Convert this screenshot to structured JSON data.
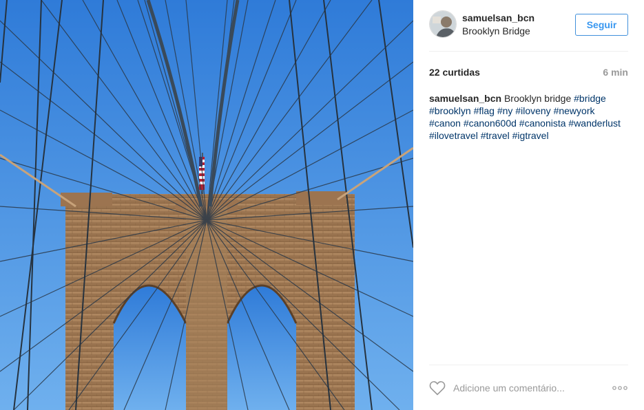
{
  "post": {
    "user": {
      "username": "samuelsan_bcn",
      "location": "Brooklyn Bridge",
      "avatar_icon": "user-avatar"
    },
    "follow_label": "Seguir",
    "likes": "22 curtidas",
    "time": "6 min",
    "caption": {
      "username": "samuelsan_bcn",
      "text": "Brooklyn bridge",
      "hashtags": [
        "#bridge",
        "#brooklyn",
        "#flag",
        "#ny",
        "#iloveny",
        "#newyork",
        "#canon",
        "#canon600d",
        "#canonista",
        "#wanderlust",
        "#ilovetravel",
        "#travel",
        "#igtravel"
      ]
    },
    "comment_placeholder": "Adicione um comentário...",
    "icons": {
      "like": "heart-icon",
      "more": "more-options-icon"
    }
  },
  "colors": {
    "accent": "#3897f0",
    "hashtag": "#003569",
    "muted": "#999999",
    "text": "#262626",
    "sky": "#4a8fe0",
    "stone": "#a07a55"
  }
}
